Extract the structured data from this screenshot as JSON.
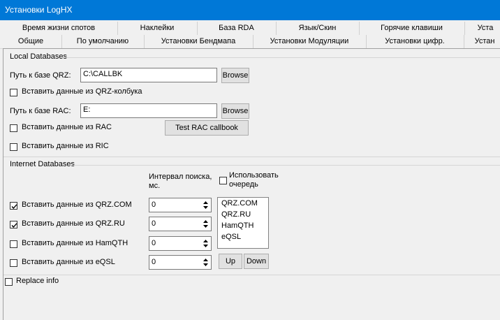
{
  "window": {
    "title": "Установки LogHX"
  },
  "tabs_row1": [
    {
      "label": "Время жизни спотов"
    },
    {
      "label": "Наклейки"
    },
    {
      "label": "База RDA"
    },
    {
      "label": "Язык/Скин"
    },
    {
      "label": "Горячие клавиши"
    },
    {
      "label": "Уста"
    }
  ],
  "tabs_row2": [
    {
      "label": "Общие"
    },
    {
      "label": "По умолчанию"
    },
    {
      "label": "Установки Бендмапа"
    },
    {
      "label": "Установки Модуляции"
    },
    {
      "label": "Установки цифр."
    },
    {
      "label": "Устан"
    }
  ],
  "local": {
    "group_label": "Local Databases",
    "qrz_path_label": "Путь к базе QRZ:",
    "qrz_path_value": "C:\\CALLBK",
    "browse1": "Browse",
    "qrz_cb_label": "Вставить данные из QRZ-колбука",
    "rac_path_label": "Путь к базе RAC:",
    "rac_path_value": "E:",
    "browse2": "Browse",
    "rac_cb_label": "Вставить данные из RAC",
    "test_rac": "Test RAC callbook",
    "ric_cb_label": "Вставить данные из RIC"
  },
  "internet": {
    "group_label": "Internet Databases",
    "interval_label_1": "Интервал поиска,",
    "interval_label_2": "мс.",
    "queue_label_1": "Использовать",
    "queue_label_2": "очередь",
    "qrzcom_label": "Вставить данные из QRZ.COM",
    "qrzcom_checked": true,
    "qrzcom_val": "0",
    "qrzru_label": "Вставить данные из QRZ.RU",
    "qrzru_checked": true,
    "qrzru_val": "0",
    "hamqth_label": "Вставить данные из HamQTH",
    "hamqth_checked": false,
    "hamqth_val": "0",
    "eqsl_label": "Вставить данные из eQSL",
    "eqsl_checked": false,
    "eqsl_val": "0",
    "order_list": [
      "QRZ.COM",
      "QRZ.RU",
      "HamQTH",
      "eQSL"
    ],
    "up_button": "Up",
    "down_button": "Down"
  },
  "replace_info_label": "Replace info"
}
